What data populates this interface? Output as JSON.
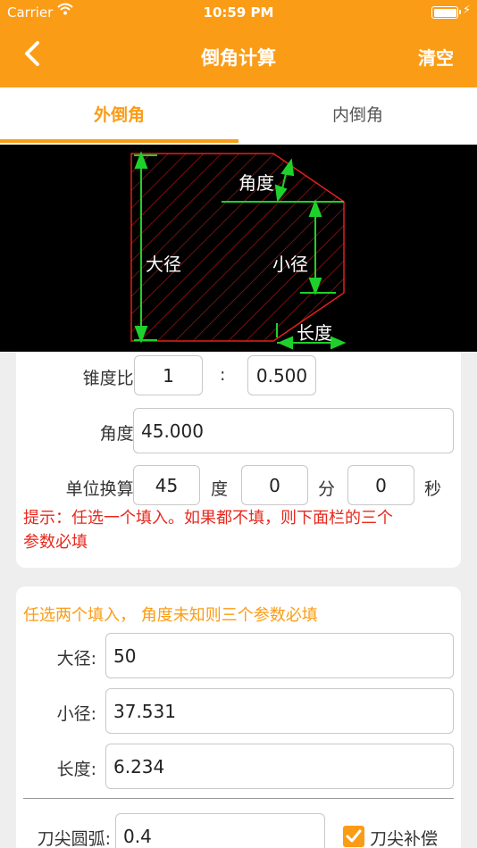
{
  "status": {
    "carrier": "Carrier",
    "time": "10:59 PM"
  },
  "nav": {
    "back_icon": "chevron-left-icon",
    "title": "倒角计算",
    "clear": "清空"
  },
  "tabs": [
    {
      "label": "外倒角",
      "active": true
    },
    {
      "label": "内倒角",
      "active": false
    }
  ],
  "diagram": {
    "angle": "角度",
    "big": "大径",
    "small": "小径",
    "length": "长度"
  },
  "taper": {
    "label": "锥度比:",
    "left": "1",
    "sep": ":",
    "right": "0.500"
  },
  "angle_row": {
    "label": "角度:",
    "value": "45.000"
  },
  "unit_row": {
    "label": "单位换算:",
    "deg": "45",
    "deg_unit": "度",
    "min": "0",
    "min_unit": "分",
    "sec": "0",
    "sec_unit": "秒"
  },
  "hint": {
    "line1": "提示：任选一个填入。如果都不填，则下面栏的三个",
    "line2": "参数必填"
  },
  "section2": {
    "subtitle": "任选两个填入， 角度未知则三个参数必填"
  },
  "fields": [
    {
      "label": "大径:",
      "value": "50"
    },
    {
      "label": "小径:",
      "value": "37.531"
    },
    {
      "label": "长度:",
      "value": "6.234"
    }
  ],
  "tip": {
    "label": "刀尖圆弧:",
    "value": "0.4",
    "check_label": "刀尖补偿",
    "checked": true
  },
  "colors": {
    "accent": "#fb9c17",
    "hint": "#e8281c",
    "diagram_red": "#e0201a",
    "diagram_green": "#1ed12a"
  }
}
